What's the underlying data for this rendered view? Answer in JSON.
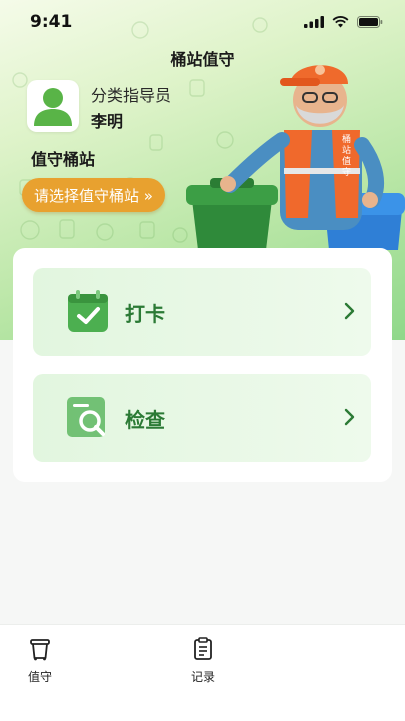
{
  "status_bar": {
    "time": "9:41"
  },
  "header": {
    "title": "桶站值守"
  },
  "profile": {
    "role": "分类指导员",
    "name": "李明"
  },
  "station": {
    "label": "值守桶站",
    "select_button": "请选择值守桶站 »"
  },
  "mascot": {
    "vest_text": "桶站值守"
  },
  "actions": [
    {
      "label": "打卡",
      "icon": "calendar-check-icon"
    },
    {
      "label": "检查",
      "icon": "search-document-icon"
    }
  ],
  "tabbar": {
    "tabs": [
      {
        "label": "值守",
        "icon": "trash-bin-icon"
      },
      {
        "label": "记录",
        "icon": "notes-icon"
      }
    ]
  },
  "colors": {
    "accent_green": "#2b7a35",
    "button_orange": "#e8a12f",
    "light_green": "#e2f6df"
  }
}
